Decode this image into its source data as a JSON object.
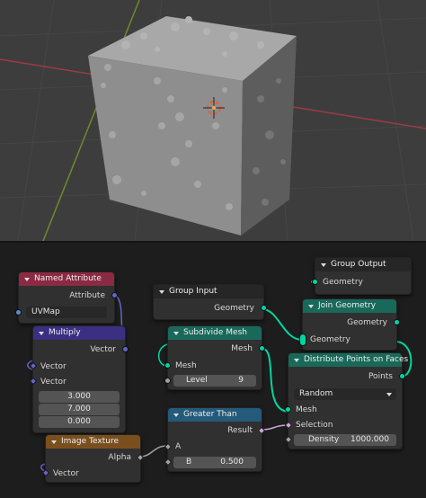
{
  "nodes": {
    "named_attribute": {
      "title": "Named Attribute",
      "output_attribute": "Attribute",
      "name_value": "UVMap",
      "color": "#8a2a43"
    },
    "multiply": {
      "title": "Multiply",
      "output_vector": "Vector",
      "input_vector_1": "Vector",
      "input_vector_2": "Vector",
      "values": [
        "3.000",
        "7.000",
        "0.000"
      ],
      "color": "#3b2f82"
    },
    "image_texture": {
      "title": "Image Texture",
      "output_alpha": "Alpha",
      "input_vector": "Vector",
      "color": "#7a4f1d"
    },
    "group_input": {
      "title": "Group Input",
      "output_geometry": "Geometry",
      "color": "#262626"
    },
    "subdivide_mesh": {
      "title": "Subdivide Mesh",
      "output_mesh": "Mesh",
      "input_mesh": "Mesh",
      "level_label": "Level",
      "level_value": "9",
      "color": "#19695a"
    },
    "greater_than": {
      "title": "Greater Than",
      "output_result": "Result",
      "input_a": "A",
      "input_b_label": "B",
      "input_b_value": "0.500",
      "color": "#245a7a"
    },
    "group_output": {
      "title": "Group Output",
      "input_geometry": "Geometry",
      "color": "#262626"
    },
    "join_geometry": {
      "title": "Join Geometry",
      "output_geometry": "Geometry",
      "input_geometry": "Geometry",
      "color": "#19695a"
    },
    "distribute_points": {
      "title": "Distribute Points on Faces",
      "output_points": "Points",
      "mode": "Random",
      "input_mesh": "Mesh",
      "input_selection": "Selection",
      "density_label": "Density",
      "density_value": "1000.000",
      "color": "#19695a"
    }
  },
  "colors": {
    "geometry_socket": "#00d6a3",
    "vector_socket": "#6363c7",
    "float_socket": "#a1a1a1",
    "string_socket": "#598bd1",
    "bool_socket": "#cca6d6",
    "viewport_bg": "#3d3d3d",
    "editor_bg": "#1d1d1d"
  }
}
